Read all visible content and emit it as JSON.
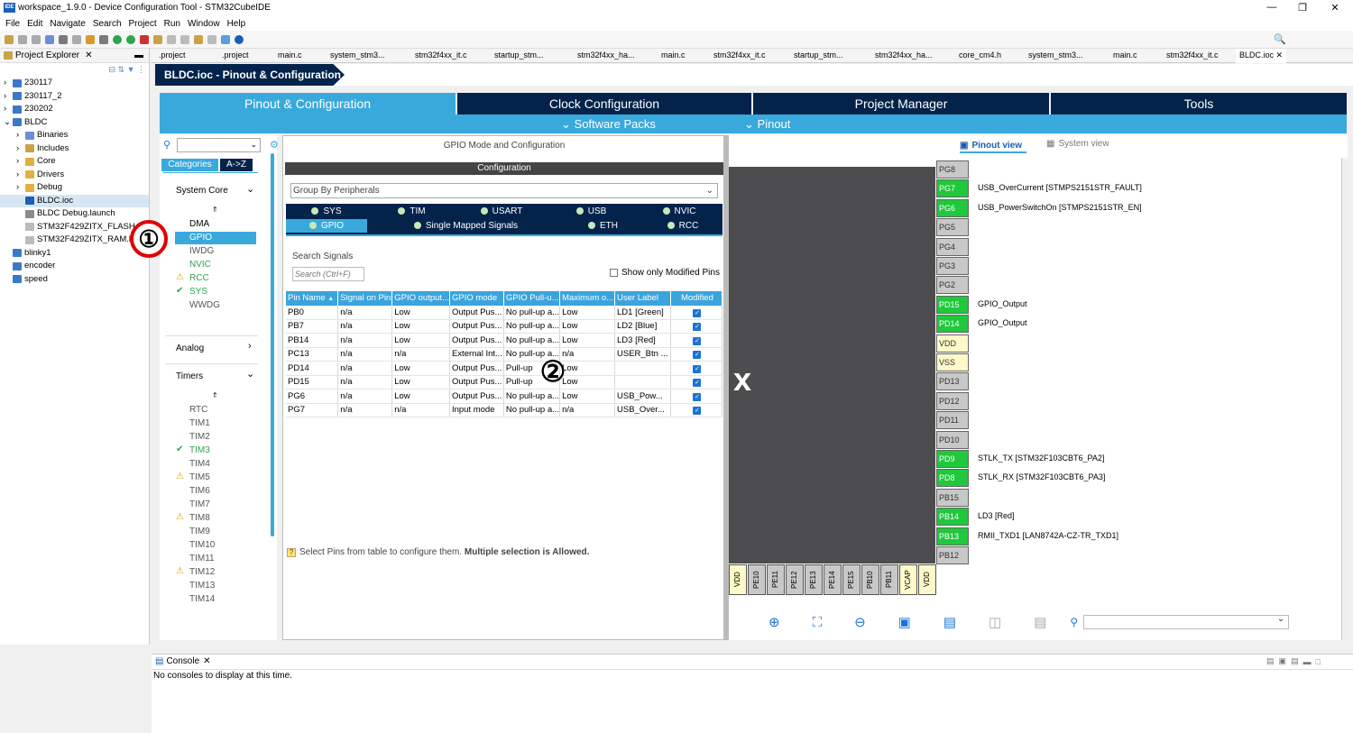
{
  "window": {
    "title": "workspace_1.9.0 - Device Configuration Tool - STM32CubeIDE"
  },
  "menu": [
    "File",
    "Edit",
    "Navigate",
    "Search",
    "Project",
    "Run",
    "Window",
    "Help"
  ],
  "explorer": {
    "title": "Project Explorer",
    "items": [
      "230117",
      "230117_2",
      "230202",
      "BLDC",
      "Binaries",
      "Includes",
      "Core",
      "Drivers",
      "Debug",
      "BLDC.ioc",
      "BLDC Debug.launch",
      "STM32F429ZITX_FLASH.ld",
      "STM32F429ZITX_RAM.ld",
      "blinky1",
      "encoder",
      "speed"
    ]
  },
  "editor_tabs": [
    ".project",
    ".project",
    "main.c",
    "system_stm3...",
    "stm32f4xx_it.c",
    "startup_stm...",
    "stm32f4xx_ha...",
    "main.c",
    "stm32f4xx_it.c",
    "startup_stm...",
    "stm32f4xx_ha...",
    "core_cm4.h",
    "system_stm3...",
    "main.c",
    "stm32f4xx_it.c",
    "BLDC.ioc"
  ],
  "ioc_title": "BLDC.ioc - Pinout & Configuration",
  "main_tabs": [
    "Pinout & Configuration",
    "Clock Configuration",
    "Project Manager",
    "Tools"
  ],
  "sub_tabs": [
    "Software Packs",
    "Pinout"
  ],
  "categories": {
    "tab_categories": "Categories",
    "tab_az": "A->Z",
    "system_core": "System Core",
    "system_items": [
      "DMA",
      "GPIO",
      "IWDG",
      "NVIC",
      "RCC",
      "SYS",
      "WWDG"
    ],
    "analog": "Analog",
    "timers": "Timers",
    "timer_items": [
      "RTC",
      "TIM1",
      "TIM2",
      "TIM3",
      "TIM4",
      "TIM5",
      "TIM6",
      "TIM7",
      "TIM8",
      "TIM9",
      "TIM10",
      "TIM11",
      "TIM12",
      "TIM13",
      "TIM14"
    ]
  },
  "gpio": {
    "header": "GPIO Mode and Configuration",
    "config_label": "Configuration",
    "group_by": "Group By Peripherals",
    "tabs_row1": [
      "SYS",
      "TIM",
      "USART",
      "USB",
      "NVIC"
    ],
    "tabs_row2": [
      "GPIO",
      "Single Mapped Signals",
      "ETH",
      "RCC"
    ],
    "search_label": "Search Signals",
    "search_placeholder": "Search (Ctrl+F)",
    "show_modified": "Show only Modified Pins",
    "columns": [
      "Pin Name",
      "Signal on Pin",
      "GPIO output...",
      "GPIO mode",
      "GPIO Pull-u...",
      "Maximum o...",
      "User Label",
      "Modified"
    ],
    "rows": [
      [
        "PB0",
        "n/a",
        "Low",
        "Output Pus...",
        "No pull-up a...",
        "Low",
        "LD1 [Green]"
      ],
      [
        "PB7",
        "n/a",
        "Low",
        "Output Pus...",
        "No pull-up a...",
        "Low",
        "LD2 [Blue]"
      ],
      [
        "PB14",
        "n/a",
        "Low",
        "Output Pus...",
        "No pull-up a...",
        "Low",
        "LD3 [Red]"
      ],
      [
        "PC13",
        "n/a",
        "n/a",
        "External Int...",
        "No pull-up a...",
        "n/a",
        "USER_Btn ..."
      ],
      [
        "PD14",
        "n/a",
        "Low",
        "Output Pus...",
        "Pull-up",
        "Low",
        ""
      ],
      [
        "PD15",
        "n/a",
        "Low",
        "Output Pus...",
        "Pull-up",
        "Low",
        ""
      ],
      [
        "PG6",
        "n/a",
        "Low",
        "Output Pus...",
        "No pull-up a...",
        "Low",
        "USB_Pow..."
      ],
      [
        "PG7",
        "n/a",
        "n/a",
        "Input mode",
        "No pull-up a...",
        "n/a",
        "USB_Over..."
      ]
    ],
    "hint": "Select Pins from table to configure them.",
    "hint_bold": "Multiple selection is Allowed."
  },
  "pinout": {
    "view_tab": "Pinout view",
    "system_tab": "System view",
    "chip_letter": "x",
    "pins": [
      {
        "name": "PG8",
        "label": "",
        "state": "gray"
      },
      {
        "name": "PG7",
        "label": "USB_OverCurrent [STMPS2151STR_FAULT]",
        "state": "green"
      },
      {
        "name": "PG6",
        "label": "USB_PowerSwitchOn [STMPS2151STR_EN]",
        "state": "green"
      },
      {
        "name": "PG5",
        "label": "",
        "state": "gray"
      },
      {
        "name": "PG4",
        "label": "",
        "state": "gray"
      },
      {
        "name": "PG3",
        "label": "",
        "state": "gray"
      },
      {
        "name": "PG2",
        "label": "",
        "state": "gray"
      },
      {
        "name": "PD15",
        "label": "GPIO_Output",
        "state": "green"
      },
      {
        "name": "PD14",
        "label": "GPIO_Output",
        "state": "green"
      },
      {
        "name": "VDD",
        "label": "",
        "state": "yellow"
      },
      {
        "name": "VSS",
        "label": "",
        "state": "yellow"
      },
      {
        "name": "PD13",
        "label": "",
        "state": "gray"
      },
      {
        "name": "PD12",
        "label": "",
        "state": "gray"
      },
      {
        "name": "PD11",
        "label": "",
        "state": "gray"
      },
      {
        "name": "PD10",
        "label": "",
        "state": "gray"
      },
      {
        "name": "PD9",
        "label": "STLK_TX [STM32F103CBT6_PA2]",
        "state": "green"
      },
      {
        "name": "PD8",
        "label": "STLK_RX [STM32F103CBT6_PA3]",
        "state": "green"
      },
      {
        "name": "PB15",
        "label": "",
        "state": "gray"
      },
      {
        "name": "PB14",
        "label": "LD3 [Red]",
        "state": "green"
      },
      {
        "name": "PB13",
        "label": "RMII_TXD1 [LAN8742A-CZ-TR_TXD1]",
        "state": "green"
      },
      {
        "name": "PB12",
        "label": "",
        "state": "gray"
      }
    ],
    "bottom_pins": [
      "VDD",
      "PE10",
      "PE11",
      "PE12",
      "PE13",
      "PE14",
      "PE15",
      "PB10",
      "PB11",
      "VCAP",
      "VDD"
    ]
  },
  "console": {
    "title": "Console",
    "message": "No consoles to display at this time."
  },
  "callouts": [
    "①",
    "②"
  ],
  "colors": {
    "accent": "#39a9dc",
    "dark": "#03234b",
    "pin_green": "#20c83c",
    "pin_yellow": "#fff8c8",
    "pin_gray": "#c8c8c8"
  }
}
